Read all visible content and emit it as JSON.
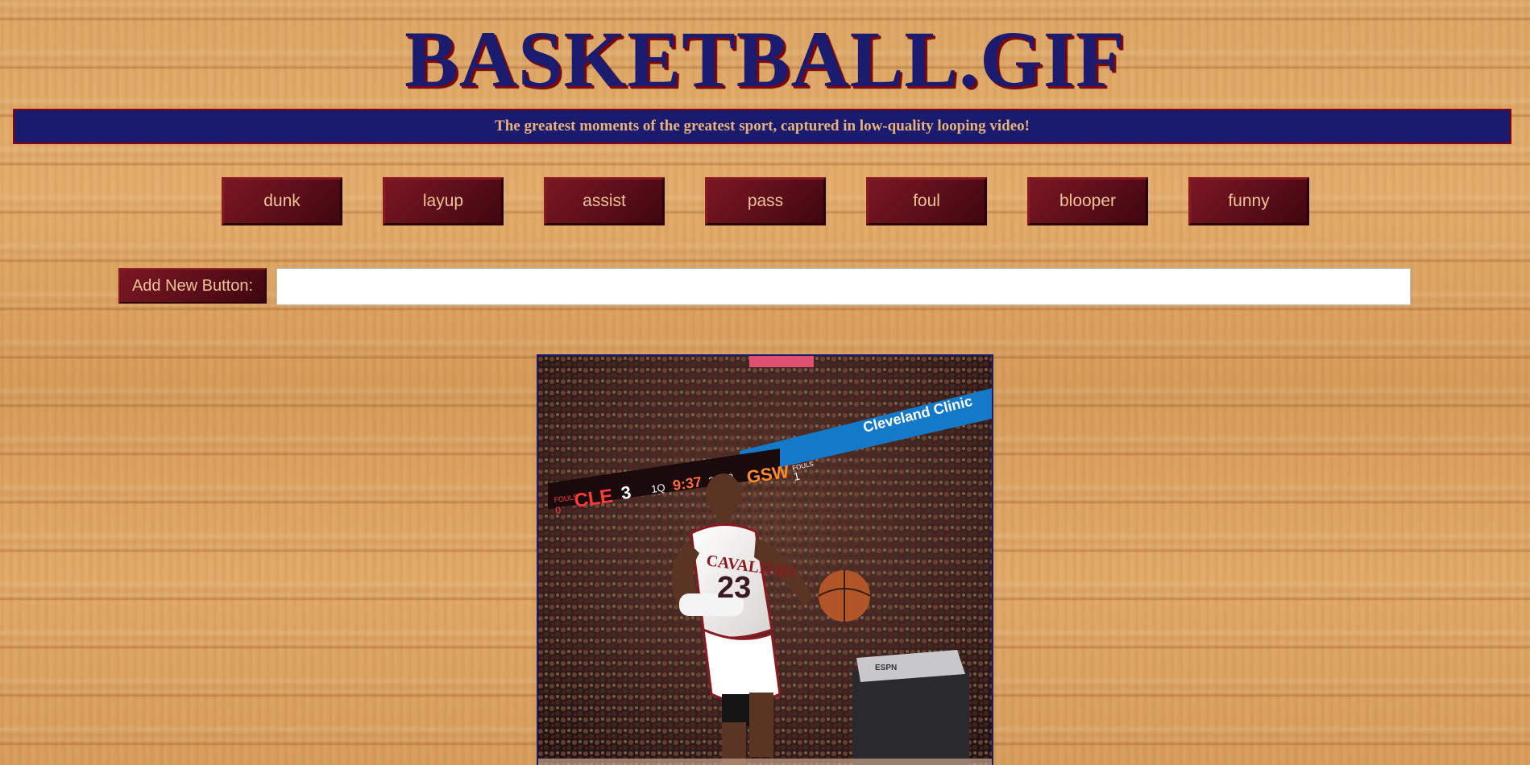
{
  "header": {
    "title": "BASKETBALL.GIF",
    "tagline": "The greatest moments of the greatest sport, captured in low-quality looping video!"
  },
  "topics": [
    {
      "label": "dunk"
    },
    {
      "label": "layup"
    },
    {
      "label": "assist"
    },
    {
      "label": "pass"
    },
    {
      "label": "foul"
    },
    {
      "label": "blooper"
    },
    {
      "label": "funny"
    }
  ],
  "add_button": {
    "label": "Add New Button:",
    "input_value": "",
    "input_placeholder": ""
  },
  "gif": {
    "scoreboard": {
      "home_team": "CLE",
      "home_score": "3",
      "home_fouls_label": "FOULS",
      "home_fouls": "0",
      "quarter": "1Q",
      "clock": "9:37",
      "shot_clock": "22",
      "away_score": "2",
      "away_team": "GSW",
      "away_fouls_label": "FOULS",
      "away_fouls": "1"
    },
    "sponsor_banner": "Cleveland Clinic",
    "jersey_name": "CAVALIERS",
    "jersey_number": "23",
    "broadcast_logo": "ESPN"
  },
  "colors": {
    "navy": "#1a1a6e",
    "maroon": "#6e1420",
    "gold": "#efc39a",
    "wood": "#d9a25e"
  }
}
